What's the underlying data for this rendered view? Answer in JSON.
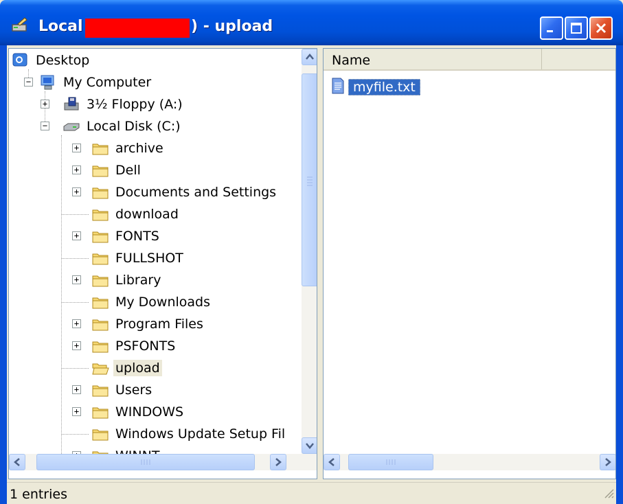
{
  "window": {
    "title_left": "Local",
    "title_right": ") - upload",
    "buttons": [
      "minimize",
      "maximize",
      "close"
    ]
  },
  "tree": {
    "items": [
      {
        "label": "Desktop",
        "icon": "desktop-icon"
      },
      {
        "label": "My Computer",
        "icon": "my-computer-icon"
      },
      {
        "label": "3½ Floppy (A:)",
        "icon": "floppy-drive-icon"
      },
      {
        "label": "Local Disk (C:)",
        "icon": "hard-disk-icon"
      },
      {
        "label": "archive",
        "icon": "folder-icon"
      },
      {
        "label": "Dell",
        "icon": "folder-icon"
      },
      {
        "label": "Documents and Settings",
        "icon": "folder-icon"
      },
      {
        "label": "download",
        "icon": "folder-icon"
      },
      {
        "label": "FONTS",
        "icon": "folder-icon"
      },
      {
        "label": "FULLSHOT",
        "icon": "folder-icon"
      },
      {
        "label": "Library",
        "icon": "folder-icon"
      },
      {
        "label": "My Downloads",
        "icon": "folder-icon"
      },
      {
        "label": "Program Files",
        "icon": "folder-icon"
      },
      {
        "label": "PSFONTS",
        "icon": "folder-icon"
      },
      {
        "label": "upload",
        "icon": "open-folder-icon",
        "selected": true
      },
      {
        "label": "Users",
        "icon": "folder-icon"
      },
      {
        "label": "WINDOWS",
        "icon": "folder-icon"
      },
      {
        "label": "Windows Update Setup Fil",
        "icon": "folder-icon"
      },
      {
        "label": "WINNT",
        "icon": "folder-icon"
      }
    ]
  },
  "list": {
    "column_name": "Name",
    "files": [
      {
        "label": "myfile.txt",
        "icon": "text-file-icon",
        "selected": true
      }
    ]
  },
  "status": {
    "text": "1 entries"
  },
  "colors": {
    "titlebar": "#0054e3",
    "selection": "#316ac5",
    "redaction": "#ff0000"
  }
}
